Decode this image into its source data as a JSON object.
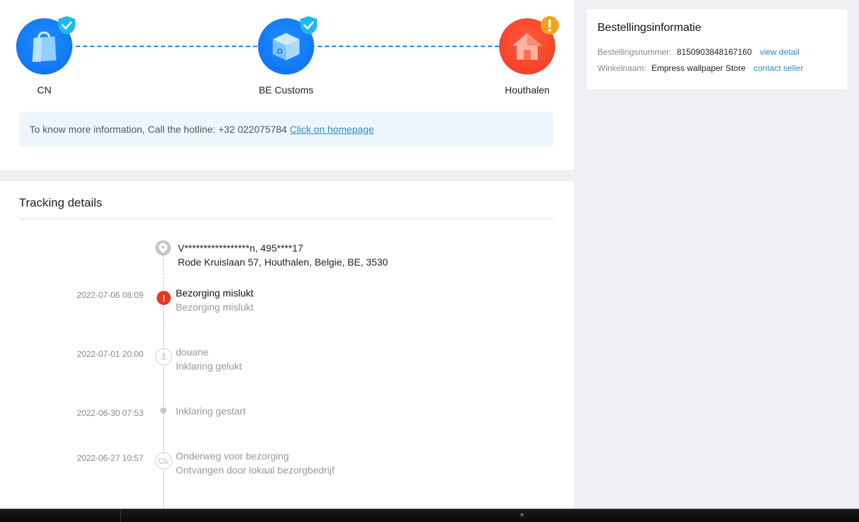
{
  "progress": {
    "stages": [
      {
        "label": "CN",
        "icon": "shopping-bag-icon",
        "status": "done"
      },
      {
        "label": "BE Customs",
        "icon": "package-box-icon",
        "status": "done"
      },
      {
        "label": "Houthalen",
        "icon": "house-icon",
        "status": "alert"
      }
    ],
    "info": {
      "text": "To know more information, Call the hotline: +32 022075784",
      "link": "Click on homepage"
    }
  },
  "tracking": {
    "title": "Tracking details",
    "address": {
      "line1": "V*****************n,  495****17",
      "line2": "Rode Kruislaan 57,  Houthalen,  Belgie,  BE,  3530"
    },
    "events": [
      {
        "time": "2022-07-06 08:09",
        "title": "Bezorging mislukt",
        "desc": "Bezorging mislukt"
      },
      {
        "time": "2022-07-01 20:00",
        "title": "douane",
        "desc": "Inklaring gelukt"
      },
      {
        "time": "2022-06-30 07:53",
        "title": "Inklaring gestart",
        "desc": ""
      },
      {
        "time": "2022-06-27 10:57",
        "title": "Onderweg voor bezorging",
        "desc": "Ontvangen door lokaal bezorgbedrijf"
      }
    ]
  },
  "order": {
    "title": "Bestellingsinformatie",
    "number_label": "Bestellingsnummer:",
    "number_value": "8150903848167160",
    "number_action": "view detail",
    "store_label": "Winkelnaam:",
    "store_value": "Empress wallpaper Store",
    "store_action": "contact seller"
  },
  "colors": {
    "accent_blue": "#0b6ef2",
    "alert_red": "#e8381b",
    "badge_cyan": "#1fb8f0",
    "badge_orange": "#f7a21b",
    "link": "#2b8ac6"
  }
}
